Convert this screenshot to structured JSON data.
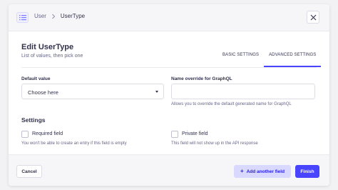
{
  "breadcrumb": {
    "parent": "User",
    "current": "UserType"
  },
  "title": "Edit UserType",
  "subtitle": "List of values, then pick one",
  "tabs": [
    {
      "label": "BASIC SETTINGS",
      "active": false
    },
    {
      "label": "ADVANCED SETTINGS",
      "active": true
    }
  ],
  "fields": {
    "default_value": {
      "label": "Default value",
      "selected": "Choose here"
    },
    "graphql_name": {
      "label": "Name override for GraphQL",
      "value": "",
      "hint": "Allows you to override the default generated name for GraphQL"
    }
  },
  "settings": {
    "title": "Settings",
    "required": {
      "label": "Required field",
      "checked": false,
      "hint": "You won't be able to create an entry if this field is empty"
    },
    "private": {
      "label": "Private field",
      "checked": false,
      "hint": "This field will not show up in the API response"
    }
  },
  "footer": {
    "cancel_label": "Cancel",
    "add_label": "Add another field",
    "finish_label": "Finish"
  },
  "colors": {
    "primary": "#4945ff",
    "primary_light": "#d9d8ff",
    "text": "#32324d",
    "muted": "#666687"
  },
  "icons": {
    "type": "enumeration-list-icon",
    "close": "close-icon",
    "separator": "chevron-right-icon",
    "select_caret": "caret-down-icon",
    "add": "plus-icon"
  }
}
